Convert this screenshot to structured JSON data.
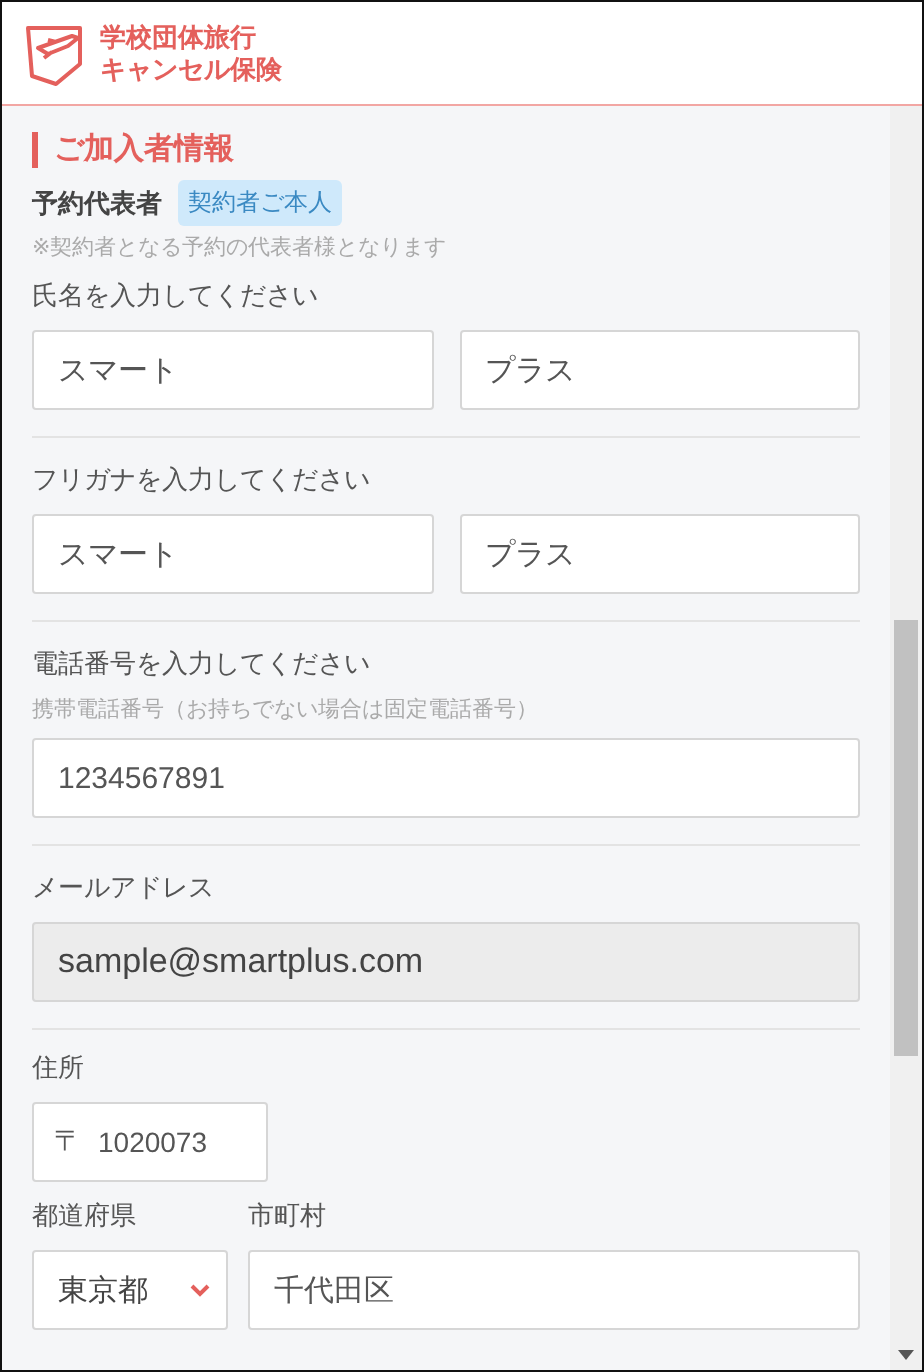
{
  "header": {
    "logo_line_1": "学校団体旅行",
    "logo_line_2": "キャンセル保険"
  },
  "section_title": "ご加入者情報",
  "representative": {
    "label": "予約代表者",
    "badge": "契約者ご本人",
    "note": "※契約者となる予約の代表者様となります"
  },
  "groups": [
    {
      "label": "氏名を入力してください",
      "fields": [
        {
          "value": "スマート",
          "disabled": false
        },
        {
          "value": "プラス",
          "disabled": false
        }
      ]
    },
    {
      "label": "フリガナを入力してください",
      "fields": [
        {
          "value": "スマート",
          "disabled": false
        },
        {
          "value": "プラス",
          "disabled": false
        }
      ]
    },
    {
      "label": "電話番号を入力してください",
      "hint": "携帯電話番号（お持ちでない場合は固定電話番号）",
      "fields": [
        {
          "value": "1234567891",
          "disabled": false
        }
      ]
    },
    {
      "label": "メールアドレス",
      "fields": [
        {
          "value": "sample@smartplus.com",
          "disabled": true
        }
      ]
    }
  ],
  "address": {
    "label": "住所",
    "postal_mark": "〒",
    "postal_code": "1020073",
    "prefecture_label": "都道府県",
    "prefecture": "東京都",
    "city_label": "市町村",
    "city": "千代田区"
  }
}
